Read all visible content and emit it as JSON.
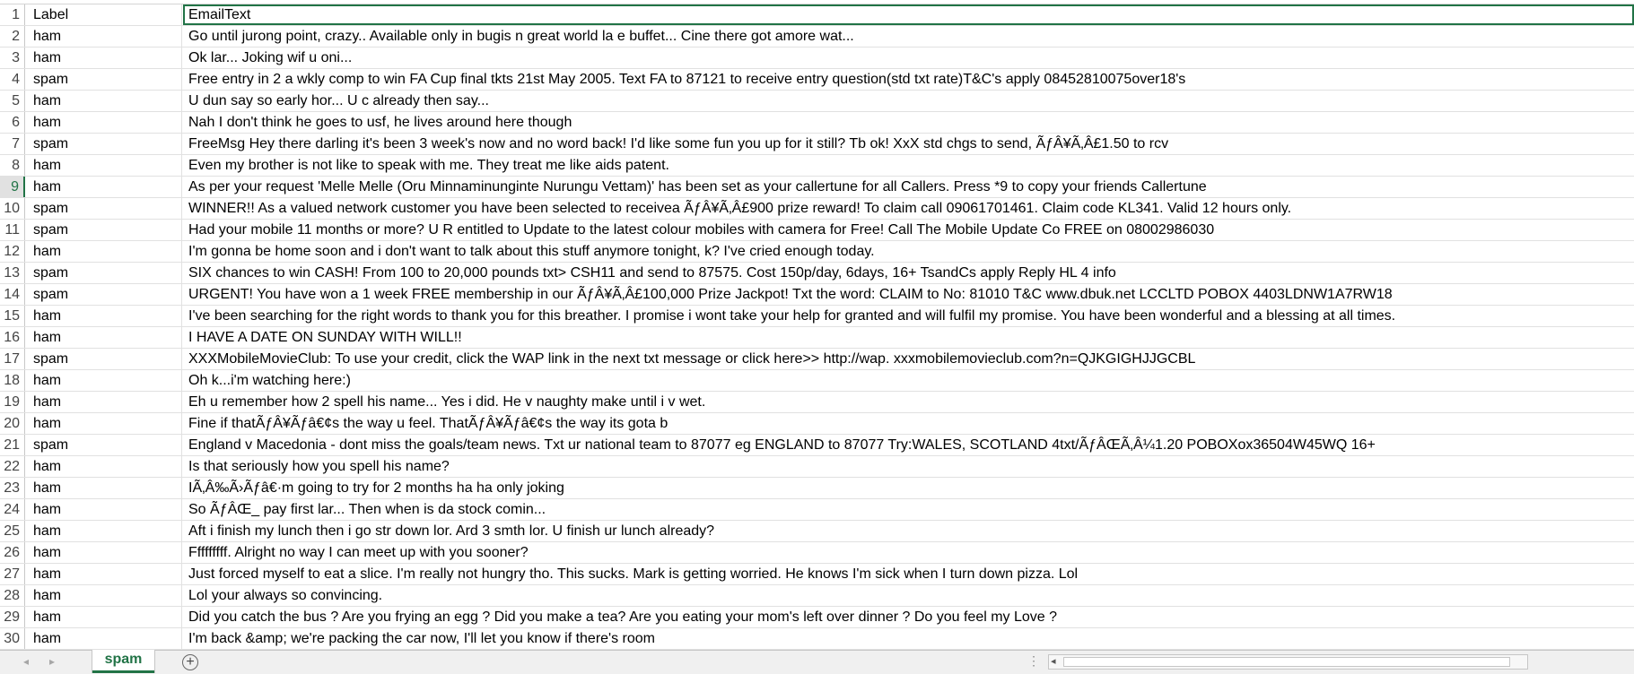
{
  "sheet": {
    "active_tab": "spam",
    "rows": [
      {
        "num": "1",
        "label": "Label",
        "text": "EmailText"
      },
      {
        "num": "2",
        "label": "ham",
        "text": "Go until jurong point, crazy.. Available only in bugis n great world la e buffet... Cine there got amore wat..."
      },
      {
        "num": "3",
        "label": "ham",
        "text": "Ok lar... Joking wif u oni..."
      },
      {
        "num": "4",
        "label": "spam",
        "text": "Free entry in 2 a wkly comp to win FA Cup final tkts 21st May 2005. Text FA to 87121 to receive entry question(std txt rate)T&C's apply 08452810075over18's"
      },
      {
        "num": "5",
        "label": "ham",
        "text": "U dun say so early hor... U c already then say..."
      },
      {
        "num": "6",
        "label": "ham",
        "text": "Nah I don't think he goes to usf, he lives around here though"
      },
      {
        "num": "7",
        "label": "spam",
        "text": "FreeMsg Hey there darling it's been 3 week's now and no word back! I'd like some fun you up for it still? Tb ok! XxX std chgs to send, ÃƒÂ¥Ã‚Â£1.50 to rcv"
      },
      {
        "num": "8",
        "label": "ham",
        "text": "Even my brother is not like to speak with me. They treat me like aids patent."
      },
      {
        "num": "9",
        "label": "ham",
        "text": "As per your request 'Melle Melle (Oru Minnaminunginte Nurungu Vettam)' has been set as your callertune for all Callers. Press *9 to copy your friends Callertune"
      },
      {
        "num": "10",
        "label": "spam",
        "text": "WINNER!! As a valued network customer you have been selected to receivea ÃƒÂ¥Ã‚Â£900 prize reward! To claim call 09061701461. Claim code KL341. Valid 12 hours only."
      },
      {
        "num": "11",
        "label": "spam",
        "text": "Had your mobile 11 months or more? U R entitled to Update to the latest colour mobiles with camera for Free! Call The Mobile Update Co FREE on 08002986030"
      },
      {
        "num": "12",
        "label": "ham",
        "text": "I'm gonna be home soon and i don't want to talk about this stuff anymore tonight, k? I've cried enough today."
      },
      {
        "num": "13",
        "label": "spam",
        "text": "SIX chances to win CASH! From 100 to 20,000 pounds txt> CSH11 and send to 87575. Cost 150p/day, 6days, 16+ TsandCs apply Reply HL 4 info"
      },
      {
        "num": "14",
        "label": "spam",
        "text": "URGENT! You have won a 1 week FREE membership in our ÃƒÂ¥Ã‚Â£100,000 Prize Jackpot! Txt the word: CLAIM to No: 81010 T&C www.dbuk.net LCCLTD POBOX 4403LDNW1A7RW18"
      },
      {
        "num": "15",
        "label": "ham",
        "text": "I've been searching for the right words to thank you for this breather. I promise i wont take your help for granted and will fulfil my promise. You have been wonderful and a blessing at all times."
      },
      {
        "num": "16",
        "label": "ham",
        "text": "I HAVE A DATE ON SUNDAY WITH WILL!!"
      },
      {
        "num": "17",
        "label": "spam",
        "text": "XXXMobileMovieClub: To use your credit, click the WAP link in the next txt message or click here>> http://wap. xxxmobilemovieclub.com?n=QJKGIGHJJGCBL"
      },
      {
        "num": "18",
        "label": "ham",
        "text": "Oh k...i'm watching here:)"
      },
      {
        "num": "19",
        "label": "ham",
        "text": "Eh u remember how 2 spell his name... Yes i did. He v naughty make until i v wet."
      },
      {
        "num": "20",
        "label": "ham",
        "text": "Fine if thatÃƒÂ¥Ãƒâ€¢s the way u feel. ThatÃƒÂ¥Ãƒâ€¢s the way its gota b"
      },
      {
        "num": "21",
        "label": "spam",
        "text": "England v Macedonia - dont miss the goals/team news. Txt ur national team to 87077 eg ENGLAND to 87077 Try:WALES, SCOTLAND 4txt/ÃƒÂŒÃ‚Â¼1.20 POBOXox36504W45WQ 16+"
      },
      {
        "num": "22",
        "label": "ham",
        "text": "Is that seriously how you spell his name?"
      },
      {
        "num": "23",
        "label": "ham",
        "text": "IÃ‚Â‰Ã›Ãƒâ€·m going to try for 2 months ha ha only joking"
      },
      {
        "num": "24",
        "label": "ham",
        "text": "So ÃƒÂŒ_ pay first lar... Then when is da stock comin..."
      },
      {
        "num": "25",
        "label": "ham",
        "text": "Aft i finish my lunch then i go str down lor. Ard 3 smth lor. U finish ur lunch already?"
      },
      {
        "num": "26",
        "label": "ham",
        "text": "Fffffffff. Alright no way I can meet up with you sooner?"
      },
      {
        "num": "27",
        "label": "ham",
        "text": "Just forced myself to eat a slice. I'm really not hungry tho. This sucks. Mark is getting worried. He knows I'm sick when I turn down pizza. Lol"
      },
      {
        "num": "28",
        "label": "ham",
        "text": "Lol your always so convincing."
      },
      {
        "num": "29",
        "label": "ham",
        "text": "Did you catch the bus ? Are you frying an egg ? Did you make a tea? Are you eating your mom's left over dinner ? Do you feel my Love ?"
      },
      {
        "num": "30",
        "label": "ham",
        "text": "I'm back &amp; we're packing the car now, I'll let you know if there's room"
      }
    ]
  },
  "ui": {
    "accent_color": "#217346",
    "nav_prev_icon": "◂",
    "nav_next_icon": "▸",
    "add_sheet_icon": "+",
    "tab_menu_icon": "⋮",
    "scroll_left_icon": "◂"
  }
}
